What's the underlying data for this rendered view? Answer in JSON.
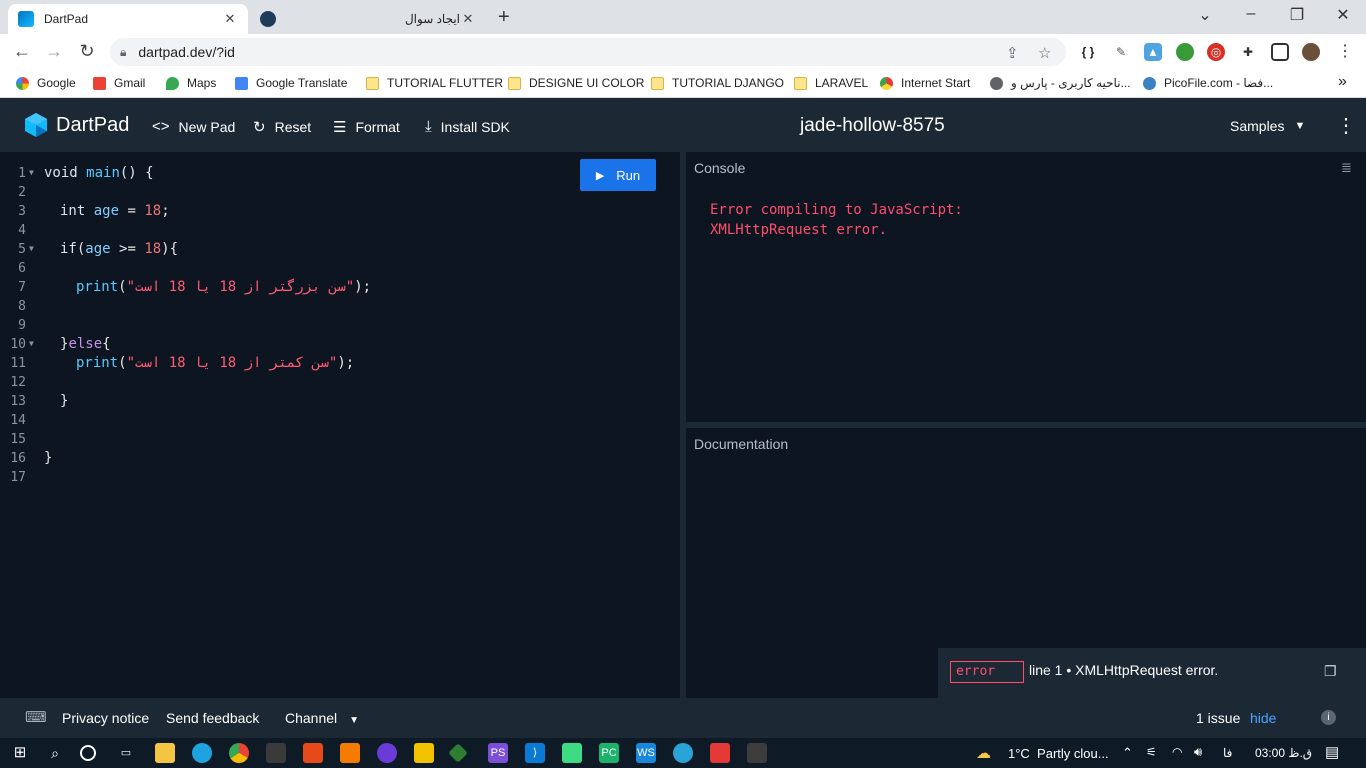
{
  "browser": {
    "tabs": [
      {
        "title": "DartPad",
        "favicon": "dart-logo-icon",
        "close": "✕"
      },
      {
        "title": "ایجاد سوال",
        "favicon": "site-logo-icon",
        "close": "✕"
      }
    ],
    "url": "dartpad.dev/?id",
    "bookmarks": [
      {
        "label": "Google",
        "icon": "google-icon"
      },
      {
        "label": "Gmail",
        "icon": "gmail-icon"
      },
      {
        "label": "Maps",
        "icon": "maps-icon"
      },
      {
        "label": "Google Translate",
        "icon": "translate-icon"
      },
      {
        "label": "TUTORIAL FLUTTER",
        "icon": "folder-icon"
      },
      {
        "label": "DESIGNE UI COLOR",
        "icon": "folder-icon"
      },
      {
        "label": "TUTORIAL DJANGO",
        "icon": "folder-icon"
      },
      {
        "label": "LARAVEL",
        "icon": "folder-icon"
      },
      {
        "label": "Internet Start",
        "icon": "internet-start-icon"
      },
      {
        "label": "ناحیه کاربری - پارس و...",
        "icon": "globe-icon"
      },
      {
        "label": "PicoFile.com - فضا...",
        "icon": "picofile-icon"
      }
    ],
    "overflow": "»"
  },
  "header": {
    "app_name": "DartPad",
    "new_pad": "New Pad",
    "reset": "Reset",
    "format": "Format",
    "install_sdk": "Install SDK",
    "pad_name": "jade-hollow-8575",
    "samples": "Samples"
  },
  "editor": {
    "run_label": "Run",
    "line_numbers": [
      "1",
      "2",
      "3",
      "4",
      "5",
      "6",
      "7",
      "8",
      "9",
      "10",
      "11",
      "12",
      "13",
      "14",
      "15",
      "16",
      "17"
    ],
    "lines": {
      "l1_kw": "void",
      "l1_fn": "main",
      "l1_rest": "() {",
      "l3_kw": "int",
      "l3_var": "age",
      "l3_op": " = ",
      "l3_num": "18",
      "l3_end": ";",
      "l5_kw": "if",
      "l5_open": "(",
      "l5_var": "age",
      "l5_op": " >= ",
      "l5_num": "18",
      "l5_close": "){",
      "l7_fn": "print",
      "l7_open": "(",
      "l7_str": "\"سن بزرگتر از 18 یا 18 است\"",
      "l7_close": ");",
      "l10_brace": "}",
      "l10_else": "else",
      "l10_open": "{",
      "l11_fn": "print",
      "l11_open": "(",
      "l11_str": "\"سن کمتر از 18 یا 18 است\"",
      "l11_close": ");",
      "l13": "}",
      "l16": "}"
    }
  },
  "console": {
    "label": "Console",
    "error_line1": "Error compiling to JavaScript:",
    "error_line2": "XMLHttpRequest error."
  },
  "documentation": {
    "label": "Documentation"
  },
  "issue": {
    "badge": "error",
    "message": "line 1 • XMLHttpRequest error."
  },
  "footer": {
    "privacy": "Privacy notice",
    "feedback": "Send feedback",
    "channel": "Channel",
    "issues": "1 issue",
    "hide": "hide"
  },
  "taskbar": {
    "weather": "1°C  Partly clou...",
    "lang": "فا",
    "time": "ق.ظ 03:00"
  },
  "colors": {
    "accent": "#1a73e8",
    "error": "#ff4d6d",
    "header_bg": "#1c2834",
    "editor_bg": "#0d1520"
  }
}
